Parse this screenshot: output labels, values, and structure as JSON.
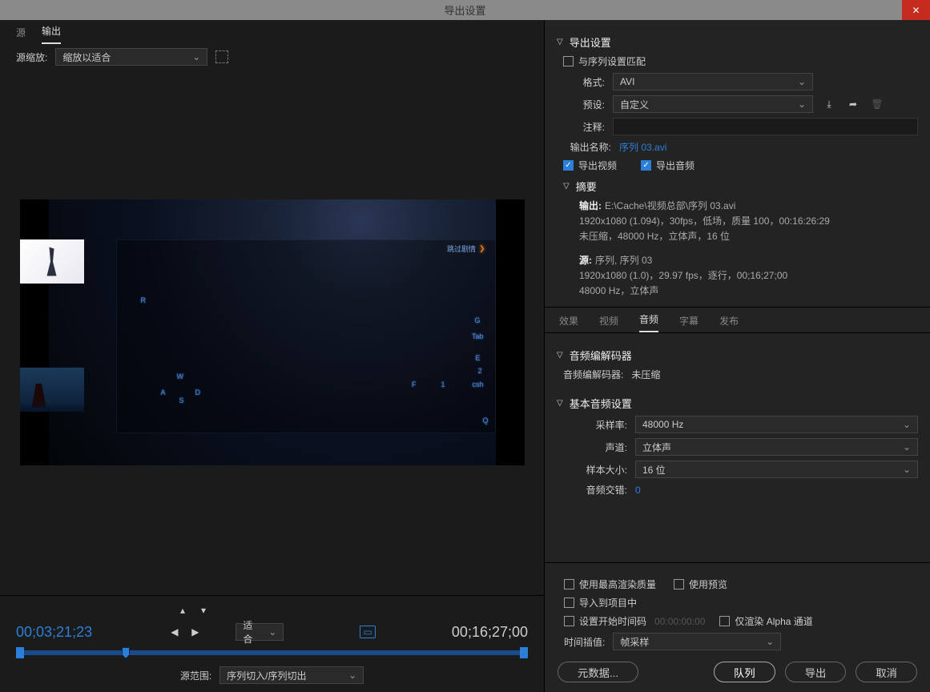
{
  "window": {
    "title": "导出设置"
  },
  "left": {
    "tabs": {
      "source": "源",
      "output": "输出"
    },
    "source_scale_label": "源缩放:",
    "source_scale_value": "缩放以适合",
    "timecode_current": "00;03;21;23",
    "timecode_total": "00;16;27;00",
    "fit_label": "适合",
    "range_label": "源范围:",
    "range_value": "序列切入/序列切出",
    "skip_text": "跳过剧情"
  },
  "export": {
    "header": "导出设置",
    "match_sequence": "与序列设置匹配",
    "format_label": "格式:",
    "format_value": "AVI",
    "preset_label": "预设:",
    "preset_value": "自定义",
    "comment_label": "注释:",
    "output_name_label": "输出名称:",
    "output_name_value": "序列 03.avi",
    "export_video": "导出视频",
    "export_audio": "导出音频",
    "summary_header": "摘要",
    "summary": {
      "output_label": "输出:",
      "output_path": "E:\\Cache\\视频总部\\序列 03.avi",
      "output_line2": "1920x1080 (1.094)，30fps，低场，质量 100，00:16:26:29",
      "output_line3": "未压缩，48000 Hz，立体声，16 位",
      "source_label": "源:",
      "source_line1": "序列, 序列 03",
      "source_line2": "1920x1080 (1.0)，29.97 fps，逐行，00;16;27;00",
      "source_line3": "48000 Hz，立体声"
    }
  },
  "tabs": {
    "effects": "效果",
    "video": "视频",
    "audio": "音频",
    "captions": "字幕",
    "publish": "发布"
  },
  "audio": {
    "codec_header": "音频编解码器",
    "codec_label": "音频编解码器:",
    "codec_value": "未压缩",
    "basic_header": "基本音频设置",
    "sample_rate_label": "采样率:",
    "sample_rate_value": "48000 Hz",
    "channels_label": "声道:",
    "channels_value": "立体声",
    "sample_size_label": "样本大小:",
    "sample_size_value": "16 位",
    "interleave_label": "音频交错:",
    "interleave_value": "0"
  },
  "bottom": {
    "max_quality": "使用最高渲染质量",
    "use_preview": "使用预览",
    "import_project": "导入到项目中",
    "set_start_tc": "设置开始时间码",
    "start_tc_value": "00:00:00:00",
    "render_alpha": "仅渲染 Alpha 通道",
    "time_interp_label": "时间插值:",
    "time_interp_value": "帧采样",
    "metadata_btn": "元数据...",
    "queue_btn": "队列",
    "export_btn": "导出",
    "cancel_btn": "取消"
  }
}
